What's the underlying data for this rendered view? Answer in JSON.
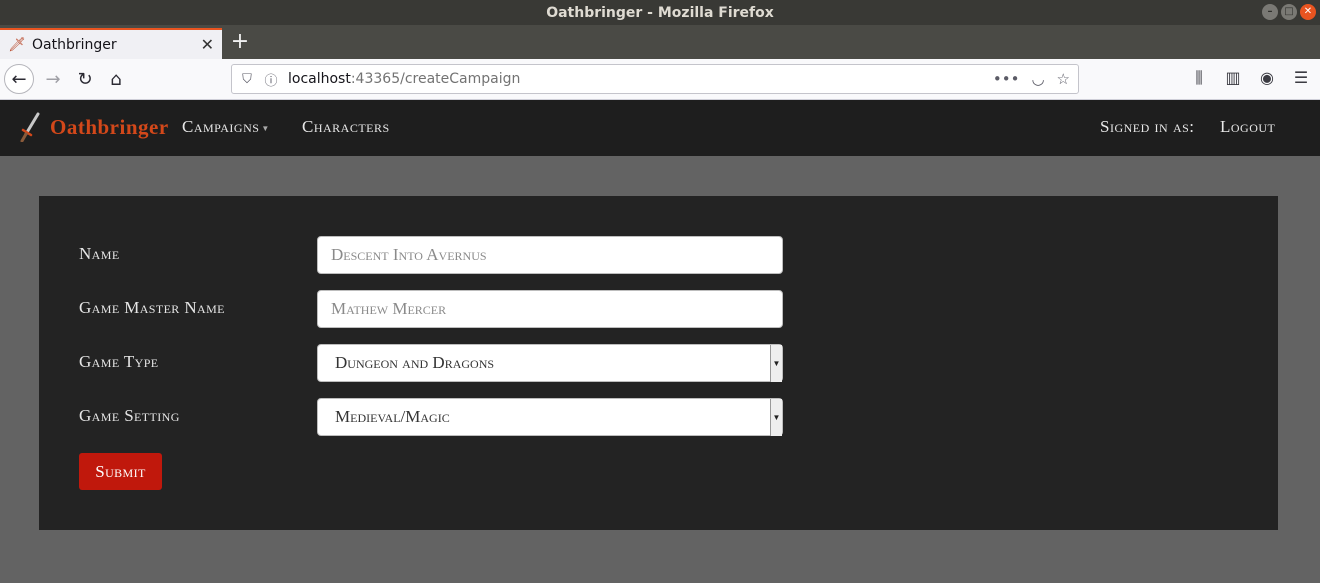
{
  "window": {
    "title": "Oathbringer - Mozilla Firefox",
    "minimize_glyph": "–",
    "maximize_glyph": "□",
    "close_glyph": "✕"
  },
  "tab": {
    "title": "Oathbringer",
    "favicon": "sword-icon",
    "close_glyph": "✕",
    "new_tab_glyph": "+"
  },
  "toolbar": {
    "back_glyph": "←",
    "forward_glyph": "→",
    "reload_glyph": "↻",
    "home_glyph": "⌂",
    "url_host": "localhost",
    "url_path": ":43365/createCampaign",
    "page_actions_glyph": "•••",
    "pocket_glyph": "◡",
    "star_glyph": "☆",
    "library_glyph": "⫼",
    "sidebar_glyph": "▥",
    "account_glyph": "◉",
    "menu_glyph": "☰"
  },
  "app": {
    "brand": "Oathbringer",
    "nav": {
      "campaigns": "Campaigns",
      "characters": "Characters",
      "signed_in": "Signed in as:",
      "logout": "Logout"
    }
  },
  "form": {
    "name": {
      "label": "Name",
      "placeholder": "Descent Into Avernus"
    },
    "gm_name": {
      "label": "Game Master Name",
      "placeholder": "Mathew Mercer"
    },
    "game_type": {
      "label": "Game Type",
      "value": "Dungeon and Dragons"
    },
    "game_setting": {
      "label": "Game Setting",
      "value": "Medieval/Magic"
    },
    "submit": "Submit"
  },
  "colors": {
    "accent": "#e95420",
    "brand": "#d3481a",
    "submit": "#c0180c",
    "app_nav_bg": "#1e1e1e",
    "card_bg": "#232323",
    "page_bg": "#636363"
  }
}
